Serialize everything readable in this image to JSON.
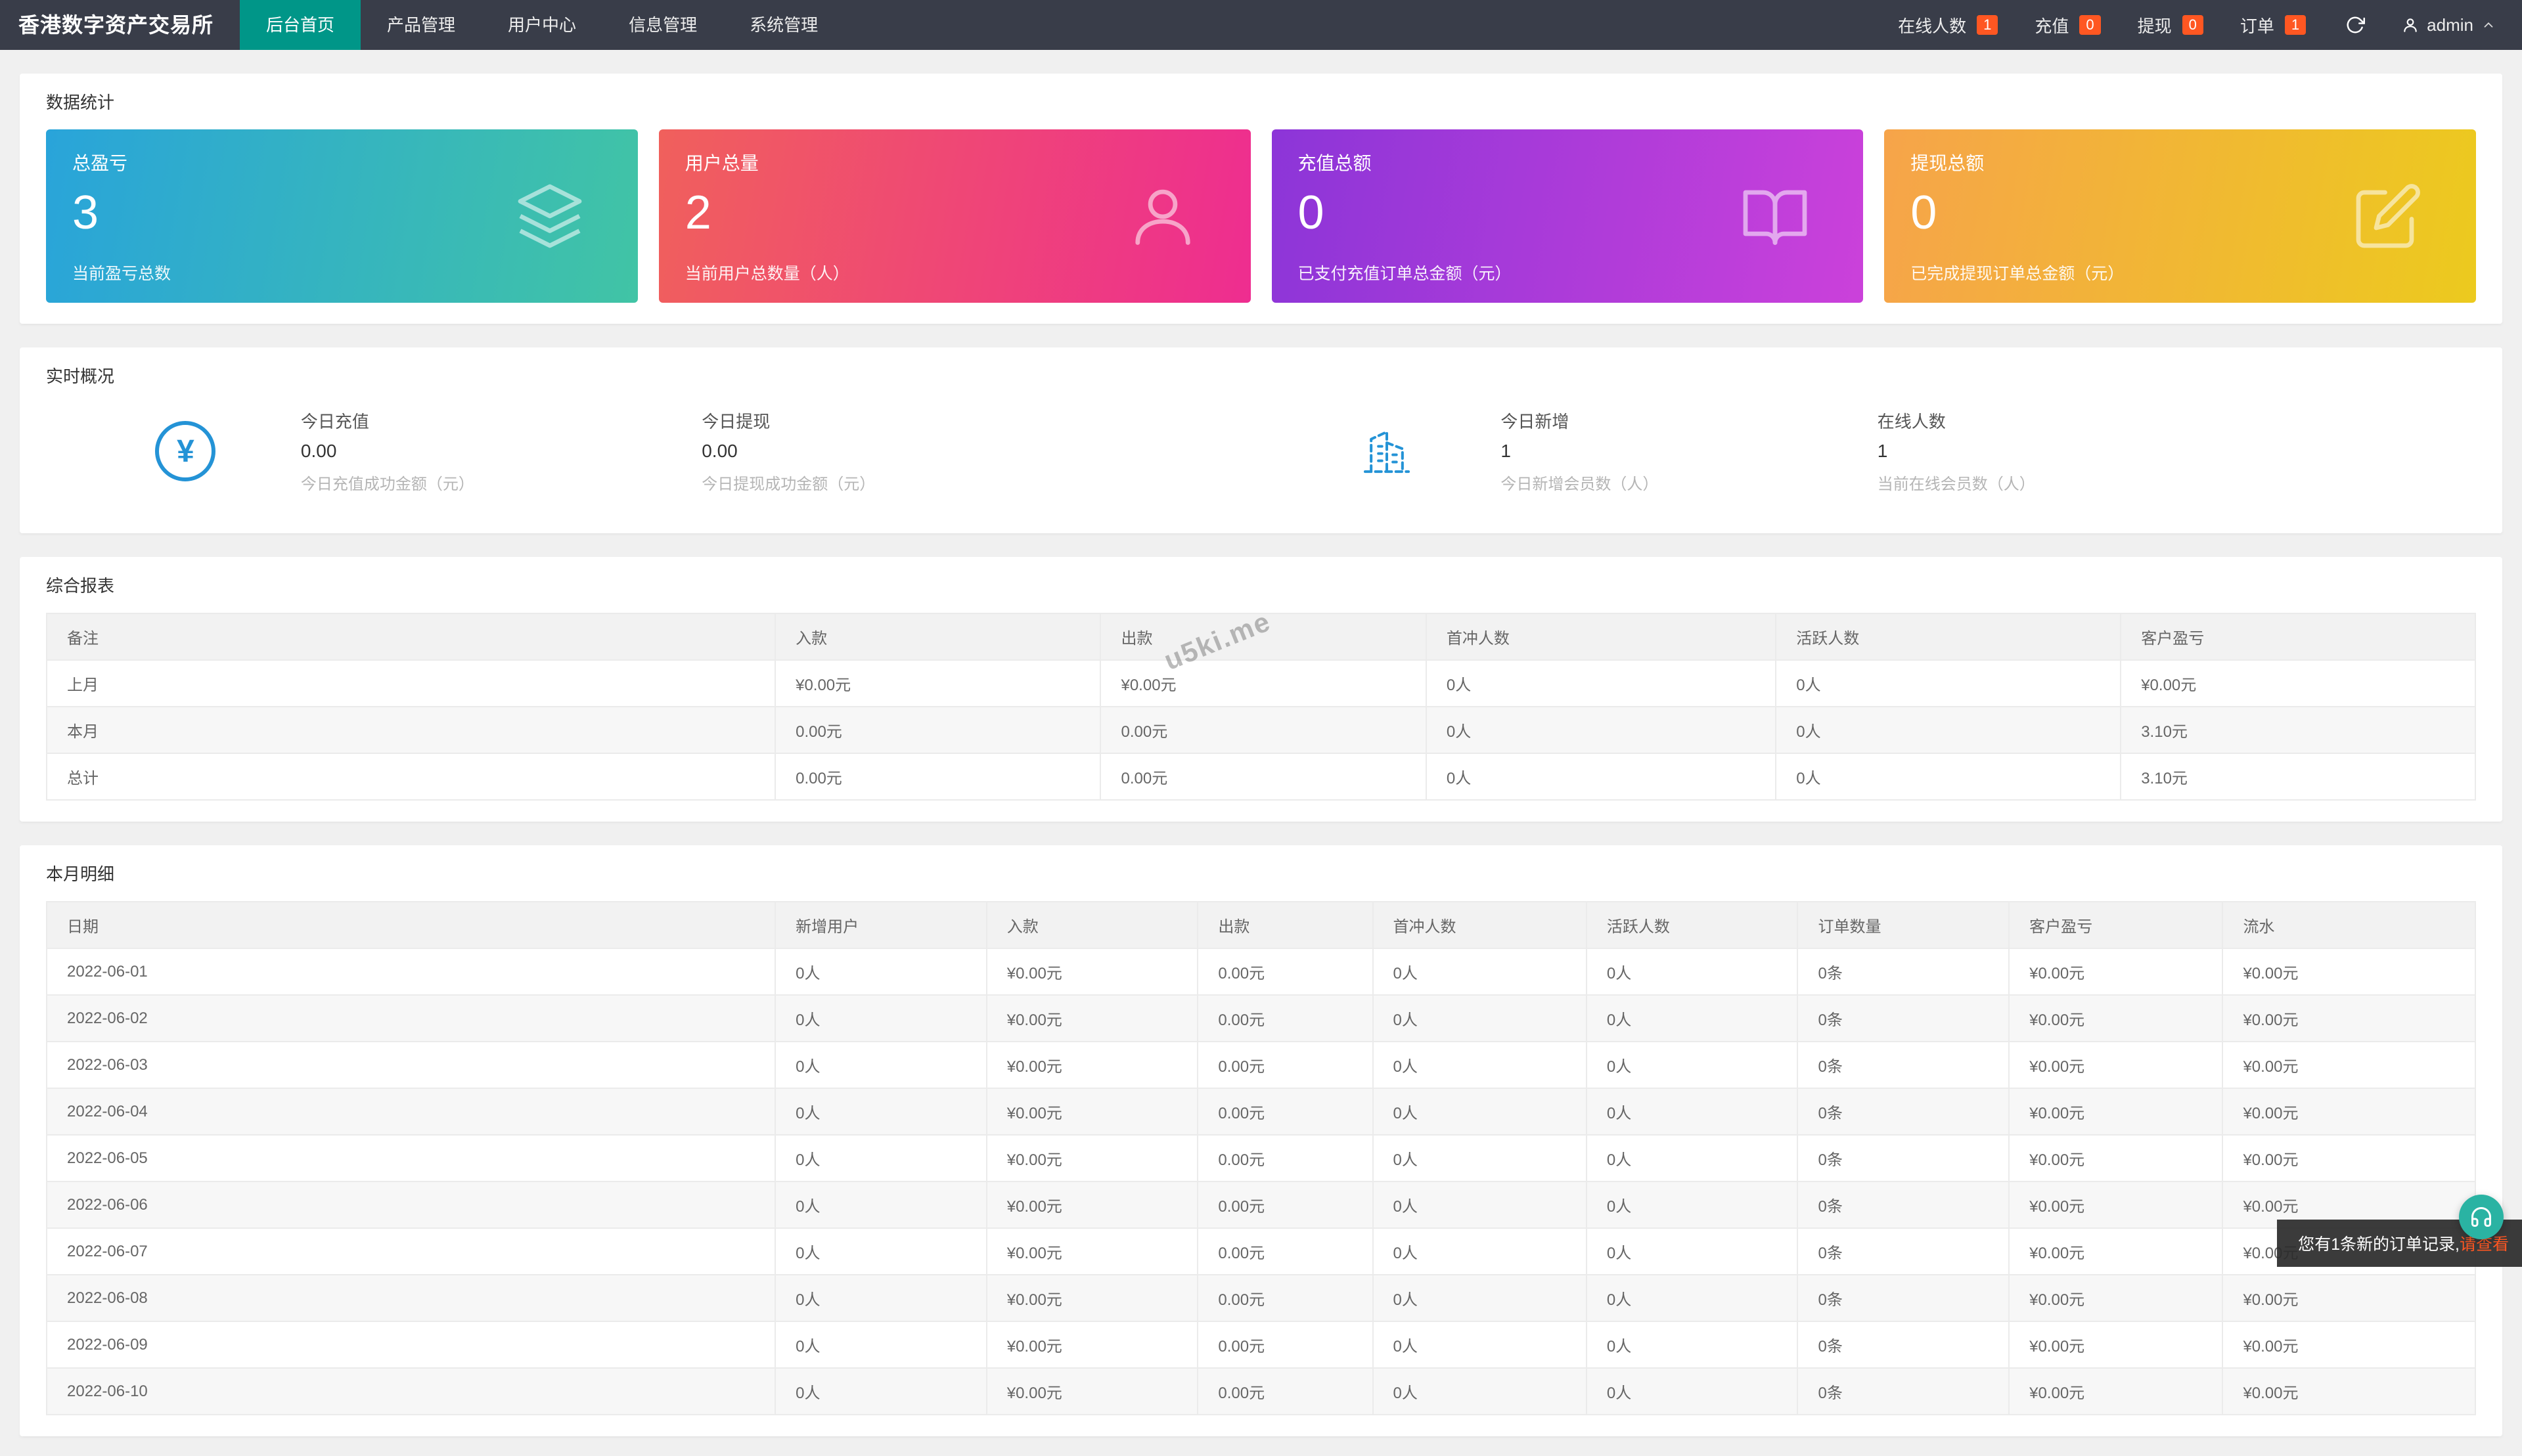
{
  "navbar": {
    "brand": "香港数字资产交易所",
    "menu": [
      {
        "label": "后台首页",
        "active": true
      },
      {
        "label": "产品管理",
        "active": false
      },
      {
        "label": "用户中心",
        "active": false
      },
      {
        "label": "信息管理",
        "active": false
      },
      {
        "label": "系统管理",
        "active": false
      }
    ],
    "right": [
      {
        "label": "在线人数",
        "badge": "1"
      },
      {
        "label": "充值",
        "badge": "0"
      },
      {
        "label": "提现",
        "badge": "0"
      },
      {
        "label": "订单",
        "badge": "1"
      }
    ],
    "user": "admin"
  },
  "stats_panel": {
    "title": "数据统计",
    "cards": [
      {
        "label": "总盈亏",
        "value": "3",
        "desc": "当前盈亏总数",
        "icon": "layers-icon",
        "gradient": [
          "#29a4da",
          "#41c4a5"
        ]
      },
      {
        "label": "用户总量",
        "value": "2",
        "desc": "当前用户总数量（人）",
        "icon": "user-icon",
        "gradient": [
          "#f0605c",
          "#ee2d90"
        ]
      },
      {
        "label": "充值总额",
        "value": "0",
        "desc": "已支付充值订单总金额（元）",
        "icon": "book-icon",
        "gradient": [
          "#8c35d8",
          "#cb41da"
        ]
      },
      {
        "label": "提现总额",
        "value": "0",
        "desc": "已完成提现订单总金额（元）",
        "icon": "edit-icon",
        "gradient": [
          "#f6a44a",
          "#ecca1e"
        ]
      }
    ]
  },
  "realtime_panel": {
    "title": "实时概况",
    "yen_symbol": "¥",
    "items": [
      {
        "label": "今日充值",
        "value": "0.00",
        "desc": "今日充值成功金额（元）"
      },
      {
        "label": "今日提现",
        "value": "0.00",
        "desc": "今日提现成功金额（元）"
      },
      {
        "label": "今日新增",
        "value": "1",
        "desc": "今日新增会员数（人）"
      },
      {
        "label": "在线人数",
        "value": "1",
        "desc": "当前在线会员数（人）"
      }
    ]
  },
  "report_panel": {
    "title": "综合报表",
    "headers": [
      "备注",
      "入款",
      "出款",
      "首冲人数",
      "活跃人数",
      "客户盈亏"
    ],
    "rows": [
      [
        "上月",
        "¥0.00元",
        "¥0.00元",
        "0人",
        "0人",
        "¥0.00元"
      ],
      [
        "本月",
        "0.00元",
        "0.00元",
        "0人",
        "0人",
        "3.10元"
      ],
      [
        "总计",
        "0.00元",
        "0.00元",
        "0人",
        "0人",
        "3.10元"
      ]
    ]
  },
  "month_panel": {
    "title": "本月明细",
    "headers": [
      "日期",
      "新增用户",
      "入款",
      "出款",
      "首冲人数",
      "活跃人数",
      "订单数量",
      "客户盈亏",
      "流水"
    ],
    "rows": [
      [
        "2022-06-01",
        "0人",
        "¥0.00元",
        "0.00元",
        "0人",
        "0人",
        "0条",
        "¥0.00元",
        "¥0.00元"
      ],
      [
        "2022-06-02",
        "0人",
        "¥0.00元",
        "0.00元",
        "0人",
        "0人",
        "0条",
        "¥0.00元",
        "¥0.00元"
      ],
      [
        "2022-06-03",
        "0人",
        "¥0.00元",
        "0.00元",
        "0人",
        "0人",
        "0条",
        "¥0.00元",
        "¥0.00元"
      ],
      [
        "2022-06-04",
        "0人",
        "¥0.00元",
        "0.00元",
        "0人",
        "0人",
        "0条",
        "¥0.00元",
        "¥0.00元"
      ],
      [
        "2022-06-05",
        "0人",
        "¥0.00元",
        "0.00元",
        "0人",
        "0人",
        "0条",
        "¥0.00元",
        "¥0.00元"
      ],
      [
        "2022-06-06",
        "0人",
        "¥0.00元",
        "0.00元",
        "0人",
        "0人",
        "0条",
        "¥0.00元",
        "¥0.00元"
      ],
      [
        "2022-06-07",
        "0人",
        "¥0.00元",
        "0.00元",
        "0人",
        "0人",
        "0条",
        "¥0.00元",
        "¥0.00元"
      ],
      [
        "2022-06-08",
        "0人",
        "¥0.00元",
        "0.00元",
        "0人",
        "0人",
        "0条",
        "¥0.00元",
        "¥0.00元"
      ],
      [
        "2022-06-09",
        "0人",
        "¥0.00元",
        "0.00元",
        "0人",
        "0人",
        "0条",
        "¥0.00元",
        "¥0.00元"
      ],
      [
        "2022-06-10",
        "0人",
        "¥0.00元",
        "0.00元",
        "0人",
        "0人",
        "0条",
        "¥0.00元",
        "¥0.00元"
      ]
    ]
  },
  "watermark": "u5ki.me",
  "toast": {
    "text": "您有1条新的订单记录,",
    "link": "请查看"
  },
  "colors": {
    "navbar_bg": "#393d49",
    "active_menu": "#009688",
    "badge": "#ff5722",
    "icon_blue": "#2493d6",
    "float_button": "#2ab3a3",
    "toast_link": "#ff5722",
    "table_header_bg": "#f2f2f2",
    "stripe_row": "#f7f7f7"
  }
}
